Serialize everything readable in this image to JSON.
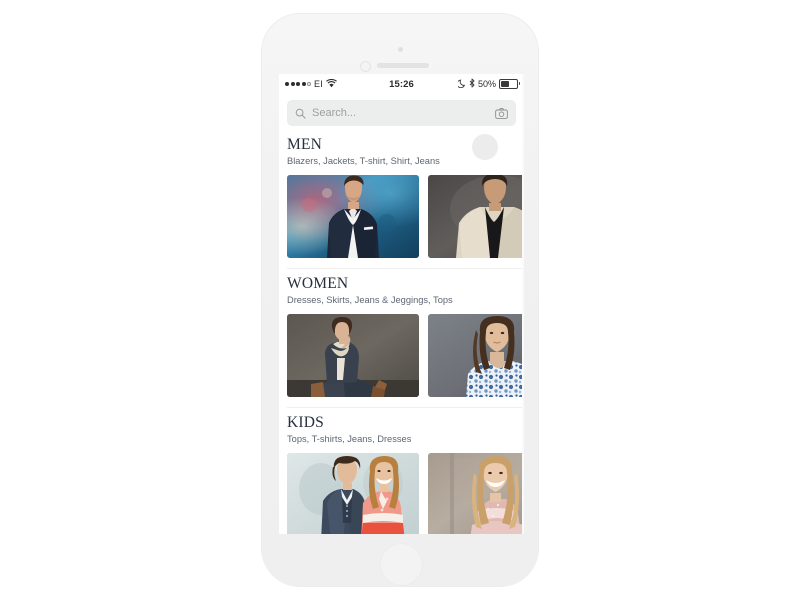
{
  "device": {
    "model": "white-smartphone",
    "frame_color": "#f2f2f2"
  },
  "status_bar": {
    "carrier": "EI",
    "signal_dots_filled": 4,
    "signal_dots_empty": 1,
    "wifi_icon": "wifi-icon",
    "time": "15:26",
    "do_not_disturb_icon": "moon-icon",
    "bluetooth_icon": "bluetooth-icon",
    "battery_percent": "50%",
    "battery_level": 50
  },
  "search": {
    "placeholder": "Search...",
    "value": "",
    "search_icon": "search-icon",
    "camera_icon": "camera-icon"
  },
  "theme": {
    "title_color": "#26303e",
    "subtitle_color": "#5d6672",
    "search_bg": "#eceded",
    "page_bg": "#ffffff",
    "badge_color": "#ececec"
  },
  "sections": [
    {
      "id": "men",
      "title": "MEN",
      "subtitle": "Blazers, Jackets, T-shirt, Shirt, Jeans",
      "has_badge": true,
      "cards": [
        {
          "id": "men-1",
          "alt": "Man in navy blazer and white shirt on blue bokeh background"
        },
        {
          "id": "men-2",
          "alt": "Man in cream bomber jacket on grey background"
        }
      ]
    },
    {
      "id": "women",
      "title": "WOMEN",
      "subtitle": "Dresses, Skirts, Jeans & Jeggings, Tops",
      "has_badge": false,
      "cards": [
        {
          "id": "women-1",
          "alt": "Woman seated in dark coat with cream scarf against grey wall"
        },
        {
          "id": "women-2",
          "alt": "Woman in blue floral print blouse on grey background"
        }
      ]
    },
    {
      "id": "kids",
      "title": "KIDS",
      "subtitle": "Tops, T-shirts, Jeans, Dresses",
      "has_badge": false,
      "cards": [
        {
          "id": "kids-1",
          "alt": "Boy in navy suit and girl in coral top on pale blue background"
        },
        {
          "id": "kids-2",
          "alt": "Girl in pink ruffled dress on beige background"
        }
      ]
    }
  ]
}
